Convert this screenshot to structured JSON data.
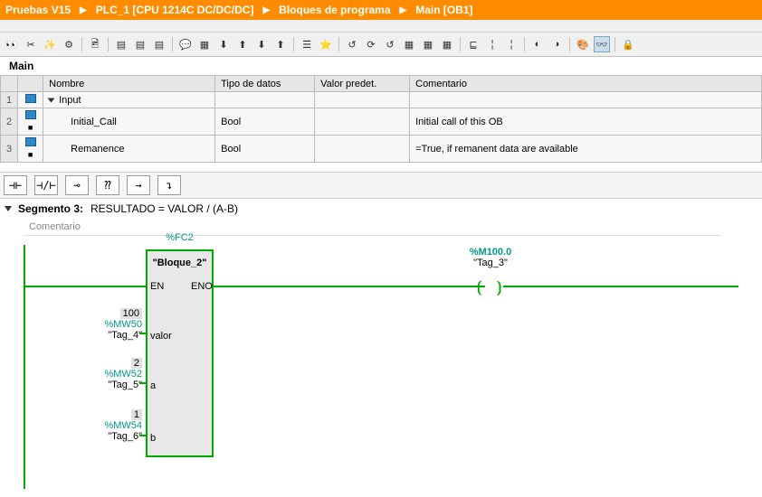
{
  "breadcrumb": [
    "Pruebas V15",
    "PLC_1 [CPU 1214C DC/DC/DC]",
    "Bloques de programa",
    "Main [OB1]"
  ],
  "mainTitle": "Main",
  "columns": [
    "Nombre",
    "Tipo de datos",
    "Valor predet.",
    "Comentario"
  ],
  "decl": {
    "section": "Input"
  },
  "rows": [
    {
      "n": "1"
    },
    {
      "n": "2",
      "name": "Initial_Call",
      "type": "Bool",
      "preset": "",
      "comment": "Initial call of this OB"
    },
    {
      "n": "3",
      "name": "Remanence",
      "type": "Bool",
      "preset": "",
      "comment": "=True, if remanent data are available"
    }
  ],
  "instr": [
    "⊣⊢",
    "⊣/⊢",
    "⊸",
    "⁇",
    "→",
    "↴"
  ],
  "segment": {
    "title": "Segmento 3:",
    "desc": "RESULTADO = VALOR / (A-B)"
  },
  "commentPlaceholder": "Comentario",
  "block": {
    "fc": "%FC2",
    "name": "\"Bloque_2\"",
    "en": "EN",
    "eno": "ENO",
    "p1": "valor",
    "p2": "a",
    "p3": "b"
  },
  "operands": [
    {
      "val": "100",
      "addr": "%MW50",
      "tag": "\"Tag_4\""
    },
    {
      "val": "2",
      "addr": "%MW52",
      "tag": "\"Tag_5\""
    },
    {
      "val": "1",
      "addr": "%MW54",
      "tag": "\"Tag_6\""
    }
  ],
  "coil": {
    "addr": "%M100.0",
    "tag": "\"Tag_3\""
  }
}
